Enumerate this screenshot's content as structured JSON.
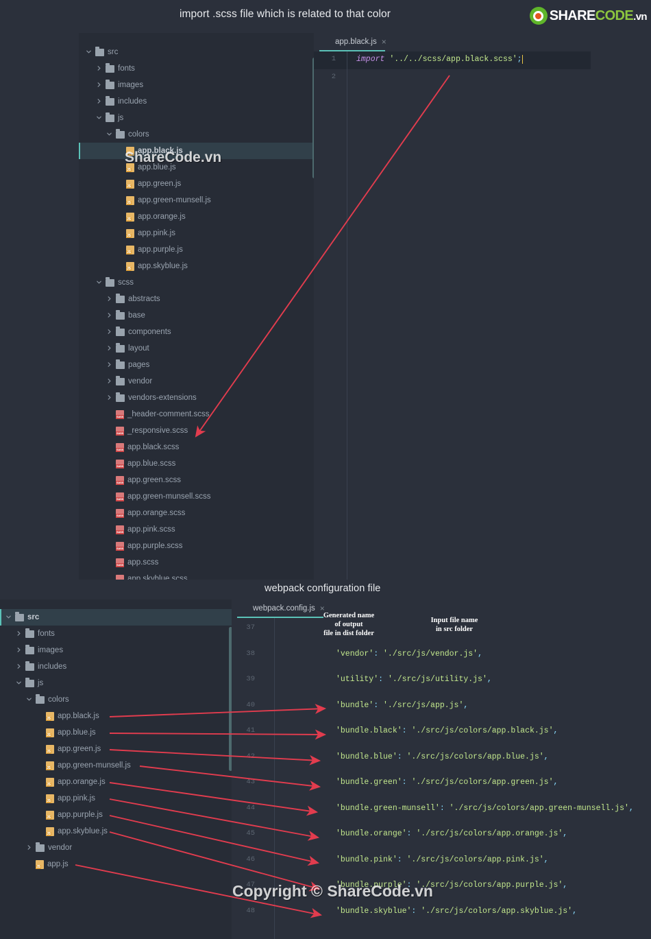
{
  "captions": {
    "top": "import .scss file which is related to that color",
    "middle": "webpack configuration file"
  },
  "logo": {
    "share": "SHARE",
    "code": "CODE",
    "vn": ".vn"
  },
  "watermarks": {
    "top": "ShareCode.vn",
    "bottom": "Copyright © ShareCode.vn"
  },
  "colors": {
    "background": "#2b303b",
    "tree_background": "#272c36",
    "selection": "#31404a",
    "accent_teal": "#5bc2b8",
    "arrow_red": "#e23c4e",
    "string_green": "#c3e88d",
    "keyword_purple": "#c792ea",
    "logo_green": "#8dc63f"
  },
  "top_panel": {
    "tree": {
      "scrollbar": true,
      "items": [
        {
          "label": "src",
          "indent": 0,
          "type": "folder",
          "twisty": "down",
          "selected": false
        },
        {
          "label": "fonts",
          "indent": 1,
          "type": "folder",
          "twisty": "right",
          "selected": false
        },
        {
          "label": "images",
          "indent": 1,
          "type": "folder",
          "twisty": "right",
          "selected": false
        },
        {
          "label": "includes",
          "indent": 1,
          "type": "folder",
          "twisty": "right",
          "selected": false
        },
        {
          "label": "js",
          "indent": 1,
          "type": "folder",
          "twisty": "down",
          "selected": false
        },
        {
          "label": "colors",
          "indent": 2,
          "type": "folder",
          "twisty": "down",
          "selected": false
        },
        {
          "label": "app.black.js",
          "indent": 3,
          "type": "js",
          "twisty": "none",
          "selected": true
        },
        {
          "label": "app.blue.js",
          "indent": 3,
          "type": "js",
          "twisty": "none",
          "selected": false
        },
        {
          "label": "app.green.js",
          "indent": 3,
          "type": "js",
          "twisty": "none",
          "selected": false
        },
        {
          "label": "app.green-munsell.js",
          "indent": 3,
          "type": "js",
          "twisty": "none",
          "selected": false
        },
        {
          "label": "app.orange.js",
          "indent": 3,
          "type": "js",
          "twisty": "none",
          "selected": false
        },
        {
          "label": "app.pink.js",
          "indent": 3,
          "type": "js",
          "twisty": "none",
          "selected": false
        },
        {
          "label": "app.purple.js",
          "indent": 3,
          "type": "js",
          "twisty": "none",
          "selected": false
        },
        {
          "label": "app.skyblue.js",
          "indent": 3,
          "type": "js",
          "twisty": "none",
          "selected": false
        },
        {
          "label": "scss",
          "indent": 1,
          "type": "folder",
          "twisty": "down",
          "selected": false
        },
        {
          "label": "abstracts",
          "indent": 2,
          "type": "folder",
          "twisty": "right",
          "selected": false
        },
        {
          "label": "base",
          "indent": 2,
          "type": "folder",
          "twisty": "right",
          "selected": false
        },
        {
          "label": "components",
          "indent": 2,
          "type": "folder",
          "twisty": "right",
          "selected": false
        },
        {
          "label": "layout",
          "indent": 2,
          "type": "folder",
          "twisty": "right",
          "selected": false
        },
        {
          "label": "pages",
          "indent": 2,
          "type": "folder",
          "twisty": "right",
          "selected": false
        },
        {
          "label": "vendor",
          "indent": 2,
          "type": "folder",
          "twisty": "right",
          "selected": false
        },
        {
          "label": "vendors-extensions",
          "indent": 2,
          "type": "folder",
          "twisty": "right",
          "selected": false
        },
        {
          "label": "_header-comment.scss",
          "indent": 2,
          "type": "scss",
          "twisty": "none",
          "selected": false
        },
        {
          "label": "_responsive.scss",
          "indent": 2,
          "type": "scss",
          "twisty": "none",
          "selected": false
        },
        {
          "label": "app.black.scss",
          "indent": 2,
          "type": "scss",
          "twisty": "none",
          "selected": false
        },
        {
          "label": "app.blue.scss",
          "indent": 2,
          "type": "scss",
          "twisty": "none",
          "selected": false
        },
        {
          "label": "app.green.scss",
          "indent": 2,
          "type": "scss",
          "twisty": "none",
          "selected": false
        },
        {
          "label": "app.green-munsell.scss",
          "indent": 2,
          "type": "scss",
          "twisty": "none",
          "selected": false
        },
        {
          "label": "app.orange.scss",
          "indent": 2,
          "type": "scss",
          "twisty": "none",
          "selected": false
        },
        {
          "label": "app.pink.scss",
          "indent": 2,
          "type": "scss",
          "twisty": "none",
          "selected": false
        },
        {
          "label": "app.purple.scss",
          "indent": 2,
          "type": "scss",
          "twisty": "none",
          "selected": false
        },
        {
          "label": "app.scss",
          "indent": 2,
          "type": "scss",
          "twisty": "none",
          "selected": false
        },
        {
          "label": "app.skyblue.scss",
          "indent": 2,
          "type": "scss",
          "twisty": "none",
          "selected": false
        }
      ]
    },
    "editor": {
      "tab": {
        "label": "app.black.js",
        "icon": "js-file-icon",
        "close": "×"
      },
      "line_numbers": [
        "1",
        "2"
      ],
      "lines": [
        {
          "n": 1,
          "keyword": "import",
          "string": "'../../scss/app.black.scss'",
          "punct": ";",
          "active": true
        },
        {
          "n": 2,
          "keyword": "",
          "string": "",
          "punct": "",
          "active": false
        }
      ]
    }
  },
  "bottom_panel": {
    "tree": {
      "items": [
        {
          "label": "src",
          "indent": 0,
          "type": "folder",
          "twisty": "down",
          "selected": true
        },
        {
          "label": "fonts",
          "indent": 1,
          "type": "folder",
          "twisty": "right",
          "selected": false
        },
        {
          "label": "images",
          "indent": 1,
          "type": "folder",
          "twisty": "right",
          "selected": false
        },
        {
          "label": "includes",
          "indent": 1,
          "type": "folder",
          "twisty": "right",
          "selected": false
        },
        {
          "label": "js",
          "indent": 1,
          "type": "folder",
          "twisty": "down",
          "selected": false
        },
        {
          "label": "colors",
          "indent": 2,
          "type": "folder",
          "twisty": "down",
          "selected": false
        },
        {
          "label": "app.black.js",
          "indent": 3,
          "type": "js",
          "twisty": "none",
          "selected": false
        },
        {
          "label": "app.blue.js",
          "indent": 3,
          "type": "js",
          "twisty": "none",
          "selected": false
        },
        {
          "label": "app.green.js",
          "indent": 3,
          "type": "js",
          "twisty": "none",
          "selected": false
        },
        {
          "label": "app.green-munsell.js",
          "indent": 3,
          "type": "js",
          "twisty": "none",
          "selected": false
        },
        {
          "label": "app.orange.js",
          "indent": 3,
          "type": "js",
          "twisty": "none",
          "selected": false
        },
        {
          "label": "app.pink.js",
          "indent": 3,
          "type": "js",
          "twisty": "none",
          "selected": false
        },
        {
          "label": "app.purple.js",
          "indent": 3,
          "type": "js",
          "twisty": "none",
          "selected": false
        },
        {
          "label": "app.skyblue.js",
          "indent": 3,
          "type": "js",
          "twisty": "none",
          "selected": false
        },
        {
          "label": "vendor",
          "indent": 2,
          "type": "folder",
          "twisty": "right",
          "selected": false
        },
        {
          "label": "app.js",
          "indent": 2,
          "type": "js",
          "twisty": "none",
          "selected": false
        }
      ]
    },
    "editor": {
      "tab": {
        "label": "webpack.config.js",
        "icon": "js-file-icon",
        "close": "×"
      },
      "annotations": [
        {
          "text": "Generated name\nof output\nfile in dist folder"
        },
        {
          "text": "Input file name\nin src folder"
        }
      ],
      "lines": [
        {
          "n": "37",
          "key": "",
          "value": ""
        },
        {
          "n": "38",
          "key": "'vendor'",
          "value": "'./src/js/vendor.js',"
        },
        {
          "n": "39",
          "key": "'utility'",
          "value": "'./src/js/utility.js',"
        },
        {
          "n": "40",
          "key": "'bundle'",
          "value": "'./src/js/app.js',"
        },
        {
          "n": "41",
          "key": "'bundle.black'",
          "value": "'./src/js/colors/app.black.js',"
        },
        {
          "n": "42",
          "key": "'bundle.blue'",
          "value": "'./src/js/colors/app.blue.js',"
        },
        {
          "n": "43",
          "key": "'bundle.green'",
          "value": "'./src/js/colors/app.green.js',"
        },
        {
          "n": "44",
          "key": "'bundle.green-munsell'",
          "value": "'./src/js/colors/app.green-munsell.js',"
        },
        {
          "n": "45",
          "key": "'bundle.orange'",
          "value": "'./src/js/colors/app.orange.js',"
        },
        {
          "n": "46",
          "key": "'bundle.pink'",
          "value": "'./src/js/colors/app.pink.js',"
        },
        {
          "n": "47",
          "key": "'bundle.purple'",
          "value": "'./src/js/colors/app.purple.js',"
        },
        {
          "n": "48",
          "key": "'bundle.skyblue'",
          "value": "'./src/js/colors/app.skyblue.js',"
        }
      ]
    }
  }
}
